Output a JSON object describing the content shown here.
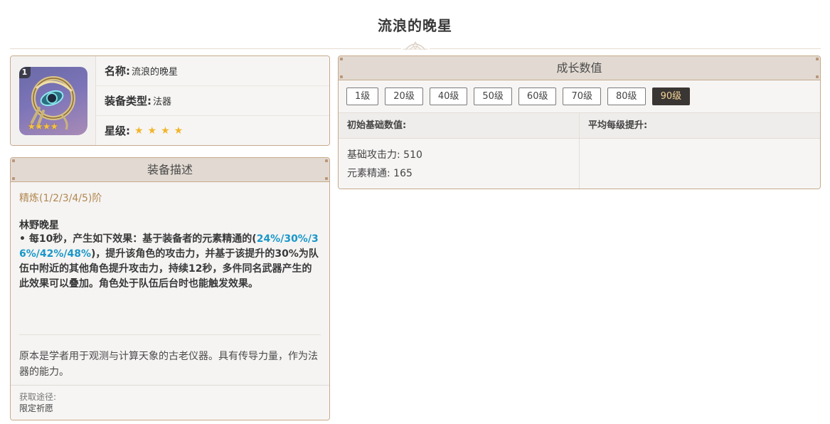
{
  "page": {
    "title": "流浪的晚星"
  },
  "info": {
    "refine_badge": "1",
    "weapon_image_icon": "catalyst-weapon-icon",
    "name_key": "名称:",
    "name_value": "流浪的晚星",
    "type_key": "装备类型:",
    "type_value": "法器",
    "rarity_key": "星级:",
    "rarity_stars": "★★★★",
    "rarity": 4
  },
  "description": {
    "header": "装备描述",
    "refine_title": "精炼(1/2/3/4/5)阶",
    "passive_name": "林野晚星",
    "passive_part1": " • 每10秒，产生如下效果：基于装备者的元素精通的(",
    "passive_highlight": "24%/30%/36%/42%/48%",
    "passive_part2": ")，提升该角色的攻击力，并基于该提升的30%为队伍中附近的其他角色提升攻击力，持续12秒，多件同名武器产生的此效果可以叠加。角色处于队伍后台时也能触发效果。",
    "lore": "原本是学者用于观测与计算天象的古老仪器。具有传导力量，作为法器的能力。",
    "source_label": "获取途径:",
    "source_value": "限定祈愿"
  },
  "growth": {
    "header": "成长数值",
    "levels": [
      "1级",
      "20级",
      "40级",
      "50级",
      "60级",
      "70级",
      "80级",
      "90级"
    ],
    "active_level": "90级",
    "base_header": "初始基础数值:",
    "avg_header": "平均每级提升:",
    "stat_atk": "基础攻击力: 510",
    "stat_em": "元素精通: 165"
  },
  "colors": {
    "accent_blue": "#1a97c8",
    "refine_gold": "#b2874f",
    "card_border": "#c7a98a",
    "active_level_bg": "#3a3634",
    "active_level_text": "#f5d596"
  }
}
